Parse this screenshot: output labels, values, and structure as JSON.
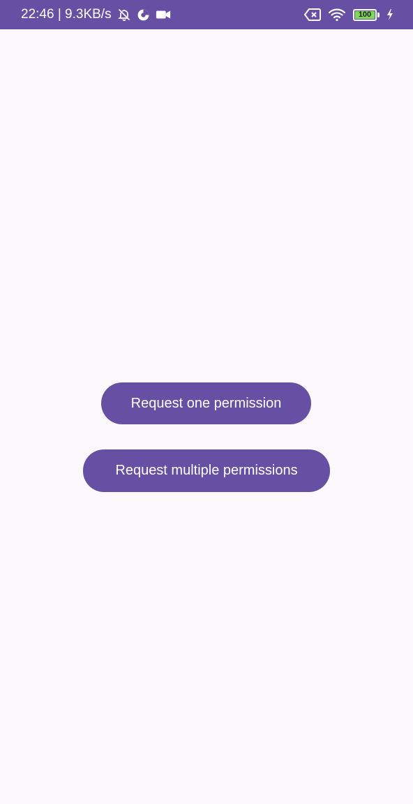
{
  "status_bar": {
    "time_speed": "22:46 | 9.3KB/s",
    "battery_level": "100",
    "battery_level_fraction": 1.0,
    "icons": [
      "notifications-off-icon",
      "data-saver-icon",
      "video-camera-icon",
      "sim-error-icon",
      "wifi-icon",
      "battery-icon",
      "charging-bolt-icon"
    ]
  },
  "main": {
    "request_one_label": "Request one permission",
    "request_multiple_label": "Request multiple permissions"
  },
  "colors": {
    "primary": "#6750a4",
    "background": "#fcf8fc",
    "battery_fill": "#7ed957"
  }
}
